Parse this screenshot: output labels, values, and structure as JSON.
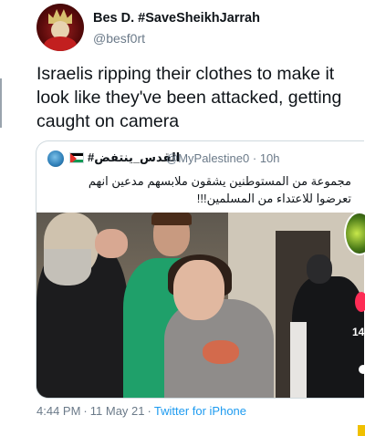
{
  "tweet": {
    "author_name": "Bes D. #SaveSheikhJarrah",
    "author_handle": "@besf0rt",
    "text": "Israelis ripping their clothes to make it look like they've been attacked, getting caught on camera",
    "timestamp": "4:44 PM",
    "date": "11 May 21",
    "source": "Twitter for iPhone"
  },
  "quoted_tweet": {
    "author_name": "#القدس_ينتفض",
    "author_handle": "@MyPalestine0",
    "age": "10h",
    "text": "مجموعة من المستوطنين يشقون ملابسهم مدعين انهم تعرضوا للاعتداء من المسلمين!!!"
  },
  "overlay": {
    "like_count": "14"
  },
  "colors": {
    "text": "#0f1419",
    "muted": "#6b7a89",
    "link": "#1d9bf0",
    "border": "#cfd9de"
  },
  "icons": {
    "quoted_flag": "palestine-flag-icon",
    "like": "heart-icon"
  }
}
